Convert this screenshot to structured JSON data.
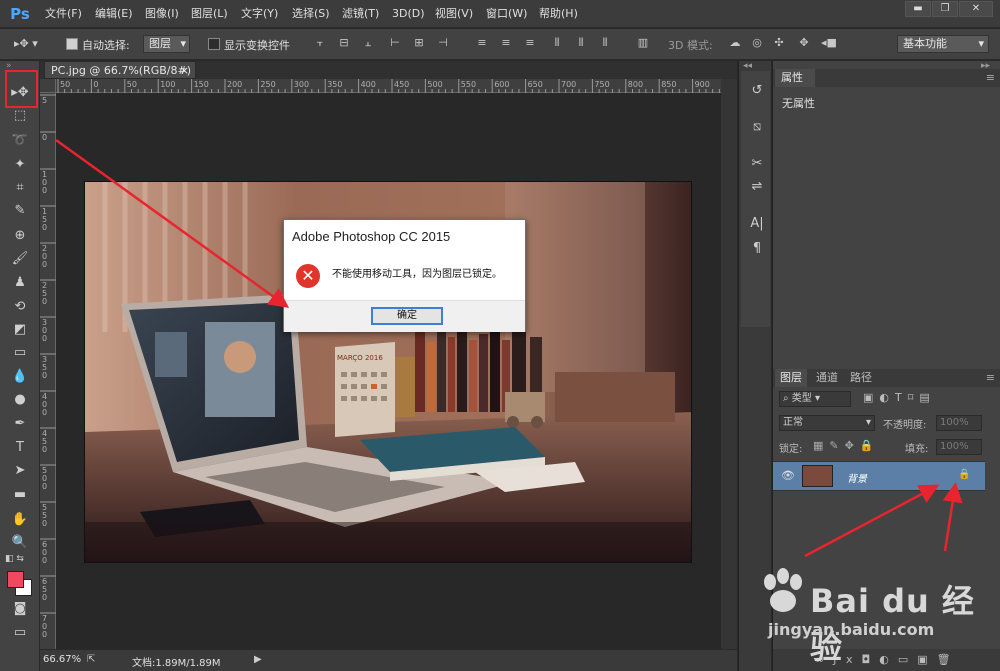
{
  "app": {
    "logo": "Ps"
  },
  "menu": [
    "文件(F)",
    "编辑(E)",
    "图像(I)",
    "图层(L)",
    "文字(Y)",
    "选择(S)",
    "滤镜(T)",
    "3D(D)",
    "视图(V)",
    "窗口(W)",
    "帮助(H)"
  ],
  "window_controls": {
    "minimize": "▬",
    "restore": "❐",
    "close": "✕"
  },
  "options_bar": {
    "auto_select_label": "自动选择:",
    "auto_select_value": "图层",
    "transform_label": "显示变换控件",
    "mode_3d_label": "3D 模式:",
    "workspace": "基本功能"
  },
  "document": {
    "tab_title": "PC.jpg @ 66.7%(RGB/8#)",
    "tab_close": "×",
    "ruler_top": [
      "50",
      "0",
      "50",
      "100",
      "150",
      "200",
      "250",
      "300",
      "350",
      "400",
      "450",
      "500",
      "550",
      "600",
      "650",
      "700",
      "750",
      "800",
      "850",
      "900"
    ],
    "ruler_left": [
      "5",
      "0",
      "1 0 0",
      "1 5 0",
      "2 0 0",
      "2 5 0",
      "3 0 0",
      "3 5 0",
      "4 0 0",
      "4 5 0",
      "5 0 0",
      "5 5 0",
      "6 0 0",
      "6 5 0",
      "7 0 0"
    ],
    "calendar_month": "MARÇO 2016"
  },
  "status": {
    "zoom": "66.67%",
    "doc_info": "文档:1.89M/1.89M"
  },
  "dialog": {
    "title": "Adobe Photoshop CC 2015",
    "message": "不能使用移动工具，因为图层已锁定。",
    "ok": "确定",
    "icon": "✕"
  },
  "properties": {
    "tab": "属性",
    "content": "无属性"
  },
  "layers": {
    "tabs": [
      "图层",
      "通道",
      "路径"
    ],
    "filter_kind": "类型",
    "blend_mode": "正常",
    "opacity_label": "不透明度:",
    "opacity_value": "100%",
    "lock_label": "锁定:",
    "fill_label": "填充:",
    "fill_value": "100%",
    "layer_name": "背景"
  },
  "watermark": {
    "brand": "Bai du 经验",
    "url": "jingyan.baidu.com"
  },
  "colors": {
    "foreground": "#f0485d",
    "background": "#ffffff",
    "highlight": "#e8242f",
    "layer_selected": "#5b7fa6"
  }
}
